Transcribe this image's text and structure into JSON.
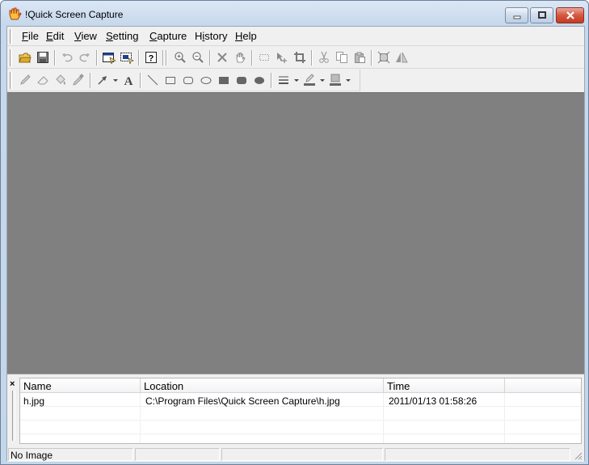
{
  "window": {
    "title": "!Quick Screen Capture",
    "app_icon": "hand-icon"
  },
  "menu": [
    "File",
    "Edit",
    "View",
    "Setting",
    "Capture",
    "History",
    "Help"
  ],
  "toolbar1_icons": [
    "open-icon",
    "save-icon",
    "undo-icon",
    "redo-icon",
    "capture-window-icon",
    "capture-region-icon",
    "help-icon",
    "zoom-in-icon",
    "zoom-out-icon",
    "delete-icon",
    "hand-pan-icon",
    "select-rect-icon",
    "move-icon",
    "crop-icon",
    "cut-icon",
    "copy-icon",
    "paste-icon",
    "resize-icon",
    "flip-icon"
  ],
  "toolbar2_icons": [
    "pencil-icon",
    "eraser-icon",
    "fill-icon",
    "eyedropper-icon",
    "arrow-tool-icon",
    "text-tool-icon",
    "line-icon",
    "rectangle-icon",
    "rounded-rect-icon",
    "ellipse-icon",
    "filled-rect-icon",
    "filled-rounded-rect-icon",
    "filled-ellipse-icon",
    "line-width-icon",
    "line-color-icon",
    "fill-color-icon"
  ],
  "history": {
    "close_glyph": "×",
    "columns": [
      "Name",
      "Location",
      "Time"
    ],
    "rows": [
      {
        "name": "h.jpg",
        "location": "C:\\Program Files\\Quick Screen Capture\\h.jpg",
        "time": "2011/01/13 01:58:26"
      }
    ]
  },
  "status": {
    "text": "No Image"
  },
  "colors": {
    "canvas": "#808080",
    "chrome": "#f0f0f0",
    "titlebar": "#c6d8ec"
  }
}
